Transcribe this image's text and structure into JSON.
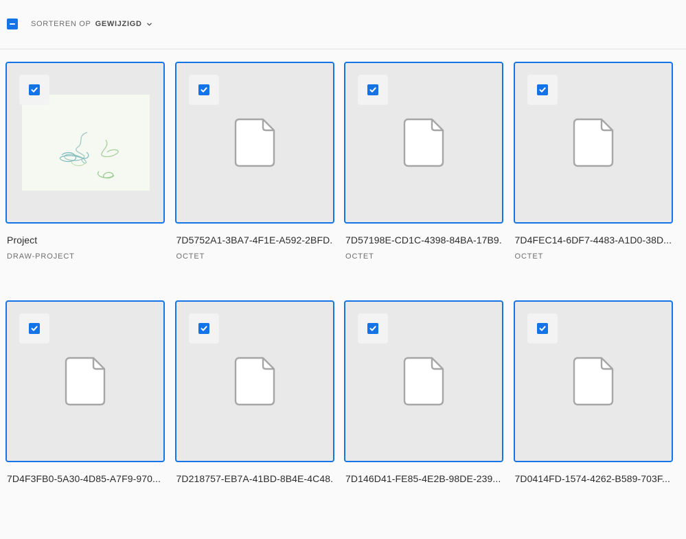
{
  "toolbar": {
    "sort_prefix": "SORTEREN OP",
    "sort_value": "GEWIJZIGD"
  },
  "colors": {
    "accent": "#1473e6",
    "thumb_bg": "#e9e9e9"
  },
  "items": [
    {
      "name": "Project",
      "type": "DRAW-PROJECT",
      "selected": true,
      "preview": "drawing"
    },
    {
      "name": "7D5752A1-3BA7-4F1E-A592-2BFD...",
      "type": "OCTET",
      "selected": true,
      "preview": "file-icon"
    },
    {
      "name": "7D57198E-CD1C-4398-84BA-17B9...",
      "type": "OCTET",
      "selected": true,
      "preview": "file-icon"
    },
    {
      "name": "7D4FEC14-6DF7-4483-A1D0-38D...",
      "type": "OCTET",
      "selected": true,
      "preview": "file-icon"
    },
    {
      "name": "7D4F3FB0-5A30-4D85-A7F9-970...",
      "type": "",
      "selected": true,
      "preview": "file-icon"
    },
    {
      "name": "7D218757-EB7A-41BD-8B4E-4C48...",
      "type": "",
      "selected": true,
      "preview": "file-icon"
    },
    {
      "name": "7D146D41-FE85-4E2B-98DE-239...",
      "type": "",
      "selected": true,
      "preview": "file-icon"
    },
    {
      "name": "7D0414FD-1574-4262-B589-703F...",
      "type": "",
      "selected": true,
      "preview": "file-icon"
    }
  ]
}
